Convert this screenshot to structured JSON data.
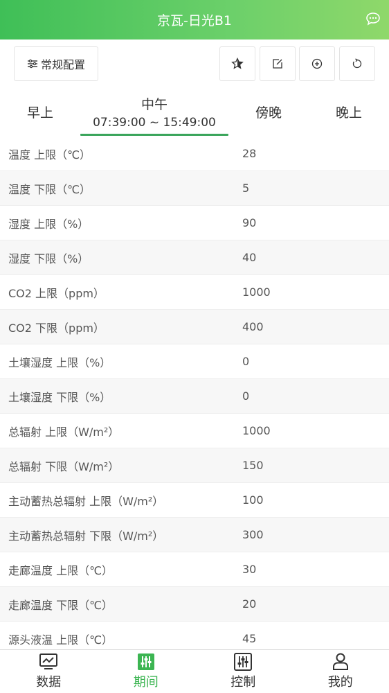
{
  "header": {
    "title": "京瓦-日光B1",
    "chat_icon": "chat-bubble-icon"
  },
  "toolbar": {
    "config_label": "常规配置",
    "config_icon": "sliders-icon",
    "icons": [
      "star-icon",
      "edit-icon",
      "add-circle-icon",
      "refresh-icon"
    ]
  },
  "periods": [
    {
      "label": "早上"
    },
    {
      "label": "中午",
      "time": "07:39:00 ~ 15:49:00",
      "active": true
    },
    {
      "label": "傍晚"
    },
    {
      "label": "晚上"
    }
  ],
  "rows": [
    {
      "label": "温度 上限（℃）",
      "value": "28"
    },
    {
      "label": "温度 下限（℃）",
      "value": "5"
    },
    {
      "label": "湿度 上限（%）",
      "value": "90"
    },
    {
      "label": "湿度 下限（%）",
      "value": "40"
    },
    {
      "label": "CO2 上限（ppm）",
      "value": "1000"
    },
    {
      "label": "CO2 下限（ppm）",
      "value": "400"
    },
    {
      "label": "土壤湿度 上限（%）",
      "value": "0"
    },
    {
      "label": "土壤湿度 下限（%）",
      "value": "0"
    },
    {
      "label": "总辐射 上限（W/m²）",
      "value": "1000"
    },
    {
      "label": "总辐射 下限（W/m²）",
      "value": "150"
    },
    {
      "label": "主动蓄热总辐射 上限（W/m²）",
      "value": "100"
    },
    {
      "label": "主动蓄热总辐射 下限（W/m²）",
      "value": "300"
    },
    {
      "label": "走廊温度 上限（℃）",
      "value": "30"
    },
    {
      "label": "走廊温度 下限（℃）",
      "value": "20"
    },
    {
      "label": "源头液温 上限（℃）",
      "value": "45"
    }
  ],
  "tabs": [
    {
      "label": "数据",
      "icon": "monitor-chart-icon"
    },
    {
      "label": "期间",
      "icon": "equalizer-icon",
      "active": true
    },
    {
      "label": "控制",
      "icon": "control-panel-icon"
    },
    {
      "label": "我的",
      "icon": "user-icon"
    }
  ],
  "colors": {
    "accent": "#3cb552",
    "header_start": "#3fbf57",
    "header_end": "#8fd86a"
  }
}
